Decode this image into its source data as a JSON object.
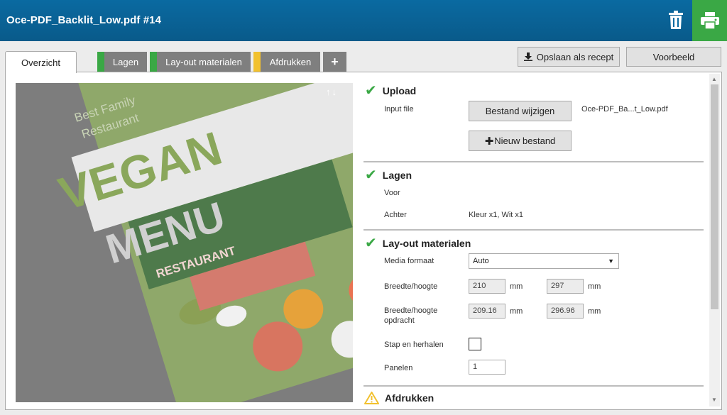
{
  "header": {
    "title": "Oce-PDF_Backlit_Low.pdf #14"
  },
  "tabs": [
    {
      "label": "Overzicht",
      "active": true
    },
    {
      "label": "Lagen",
      "color": "#3aa845"
    },
    {
      "label": "Lay-out materialen",
      "color": "#3aa845"
    },
    {
      "label": "Afdrukken",
      "color": "#f2c12e"
    },
    {
      "label": "+"
    }
  ],
  "toolbar": {
    "save_recipe": "Opslaan als recept",
    "preview": "Voorbeeld"
  },
  "preview_image": {
    "line1": "Best Family",
    "line2": "Restaurant",
    "vegan": "VEGAN",
    "menu": "MENU",
    "restaurant": "RESTAURANT",
    "arrows": "↑↓"
  },
  "upload": {
    "title": "Upload",
    "input_file_label": "Input file",
    "change_file_button": "Bestand wijzigen",
    "file_name": "Oce-PDF_Ba...t_Low.pdf",
    "new_file_button": "Nieuw bestand"
  },
  "layers": {
    "title": "Lagen",
    "front_label": "Voor",
    "back_label": "Achter",
    "back_value": "Kleur x1, Wit x1"
  },
  "layout": {
    "title": "Lay-out materialen",
    "media_format_label": "Media formaat",
    "media_format_value": "Auto",
    "width_height_label": "Breedte/hoogte",
    "width_value": "210",
    "height_value": "297",
    "unit": "mm",
    "job_size_label_1": "Breedte/hoogte",
    "job_size_label_2": "opdracht",
    "job_width_value": "209.16",
    "job_height_value": "296.96",
    "step_repeat_label": "Stap en herhalen",
    "panels_label": "Panelen",
    "panels_value": "1"
  },
  "print": {
    "title": "Afdrukken"
  },
  "colors": {
    "header": "#0a6aa1",
    "success": "#3aa845",
    "warning": "#f2c12e"
  }
}
